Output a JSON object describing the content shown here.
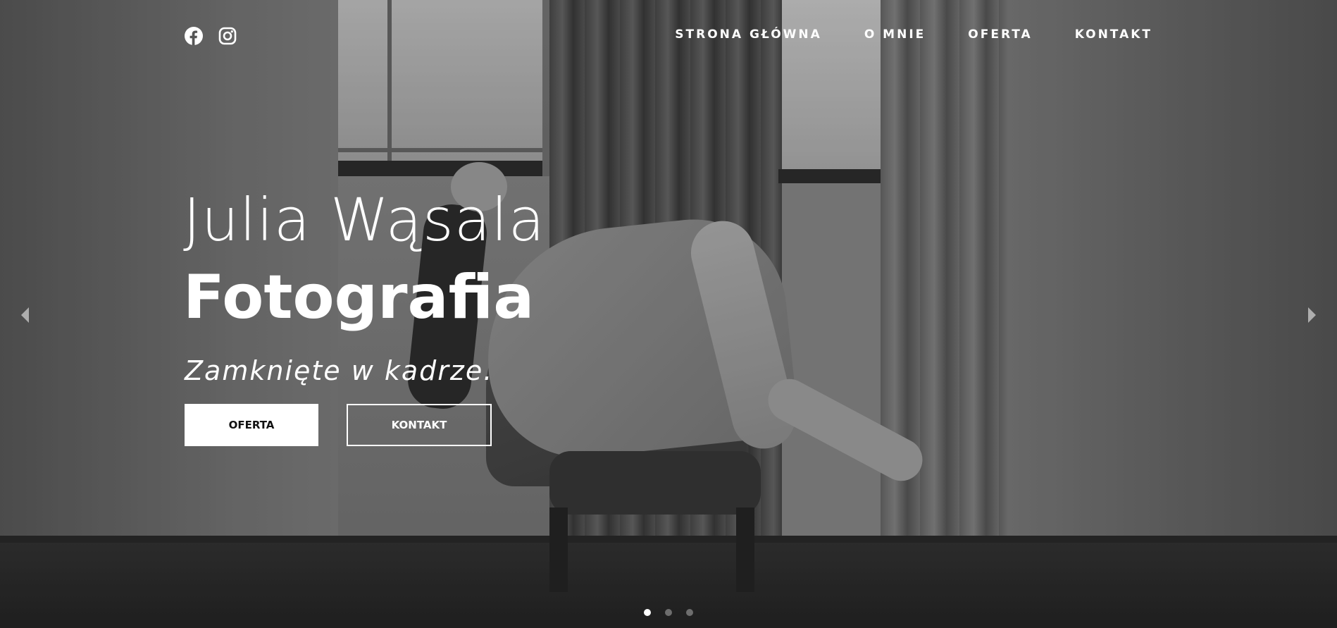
{
  "social": {
    "items": [
      {
        "icon": "facebook-icon"
      },
      {
        "icon": "instagram-icon"
      }
    ]
  },
  "nav": {
    "items": [
      {
        "label": "STRONA GŁÓWNA"
      },
      {
        "label": "O MNIE"
      },
      {
        "label": "OFERTA"
      },
      {
        "label": "KONTAKT"
      }
    ]
  },
  "hero": {
    "title": "Julia Wąsala",
    "subtitle": "Fotografia",
    "tagline": "Zamknięte w kadrze.",
    "primary_button": "OFERTA",
    "secondary_button": "KONTAKT"
  },
  "slider": {
    "slide_count": 3,
    "active_slide": 1,
    "prev_icon": "caret-left-icon",
    "next_icon": "caret-right-icon"
  },
  "colors": {
    "text": "#ffffff",
    "primary_button_bg": "#ffffff",
    "primary_button_text": "#111111"
  }
}
